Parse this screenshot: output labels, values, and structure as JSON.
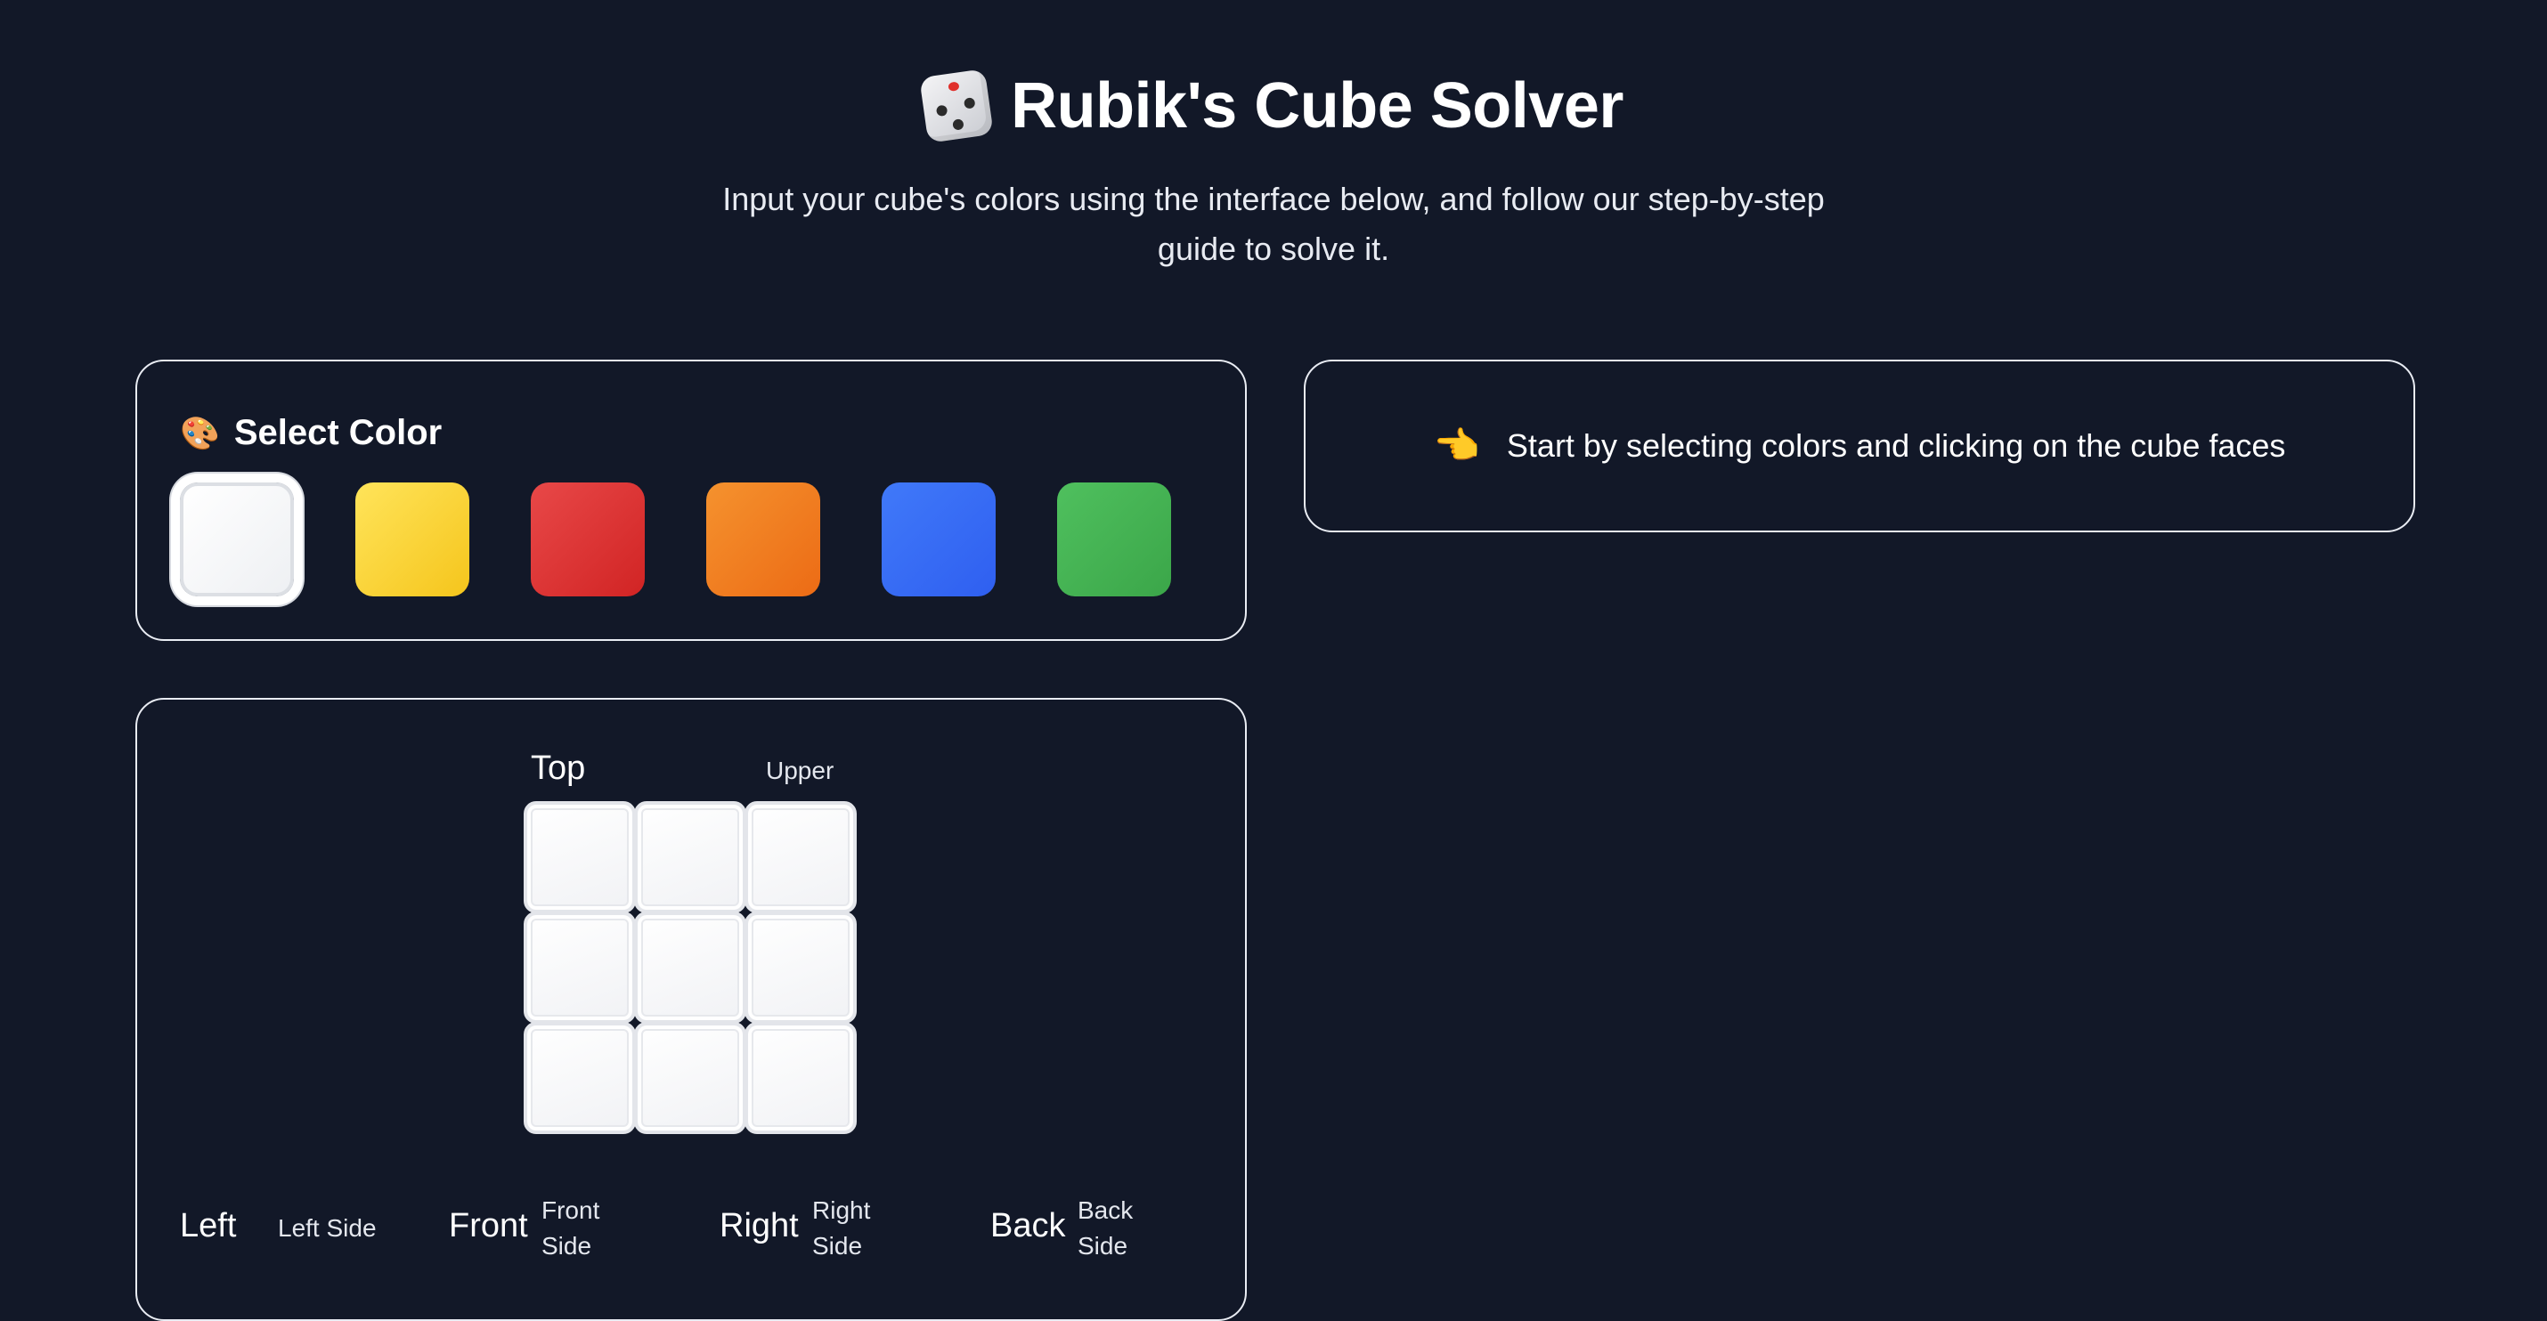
{
  "header": {
    "title": "Rubik's Cube Solver",
    "title_icon": "dice-icon",
    "subtitle": "Input your cube's colors using the interface below, and follow our step-by-step guide to solve it."
  },
  "color_panel": {
    "heading": "Select Color",
    "heading_icon": "palette-icon",
    "selected": "white",
    "colors": [
      {
        "name": "white",
        "hex_from": "#ffffff",
        "hex_to": "#eef0f3"
      },
      {
        "name": "yellow",
        "hex_from": "#ffe45a",
        "hex_to": "#f5c51c"
      },
      {
        "name": "red",
        "hex_from": "#e84848",
        "hex_to": "#d12424"
      },
      {
        "name": "orange",
        "hex_from": "#f5922e",
        "hex_to": "#ec6b15"
      },
      {
        "name": "blue",
        "hex_from": "#4079f9",
        "hex_to": "#2f5ff0"
      },
      {
        "name": "green",
        "hex_from": "#4fc05e",
        "hex_to": "#3ba649"
      }
    ]
  },
  "hint": {
    "icon": "pointing-hand-icon",
    "text": "Start by selecting colors and clicking on the cube faces"
  },
  "cube": {
    "top": {
      "label": "Top",
      "sub": "Upper",
      "stickers": [
        "white",
        "white",
        "white",
        "white",
        "white",
        "white",
        "white",
        "white",
        "white"
      ]
    },
    "left": {
      "label": "Left",
      "sub": "Left Side"
    },
    "front": {
      "label": "Front",
      "sub_line1": "Front",
      "sub_line2": "Side"
    },
    "right": {
      "label": "Right",
      "sub_line1": "Right",
      "sub_line2": "Side"
    },
    "back": {
      "label": "Back",
      "sub_line1": "Back",
      "sub_line2": "Side"
    }
  },
  "colors": {
    "background": "#121828",
    "panel_border": "#e9ecf3",
    "text": "#ffffff"
  }
}
